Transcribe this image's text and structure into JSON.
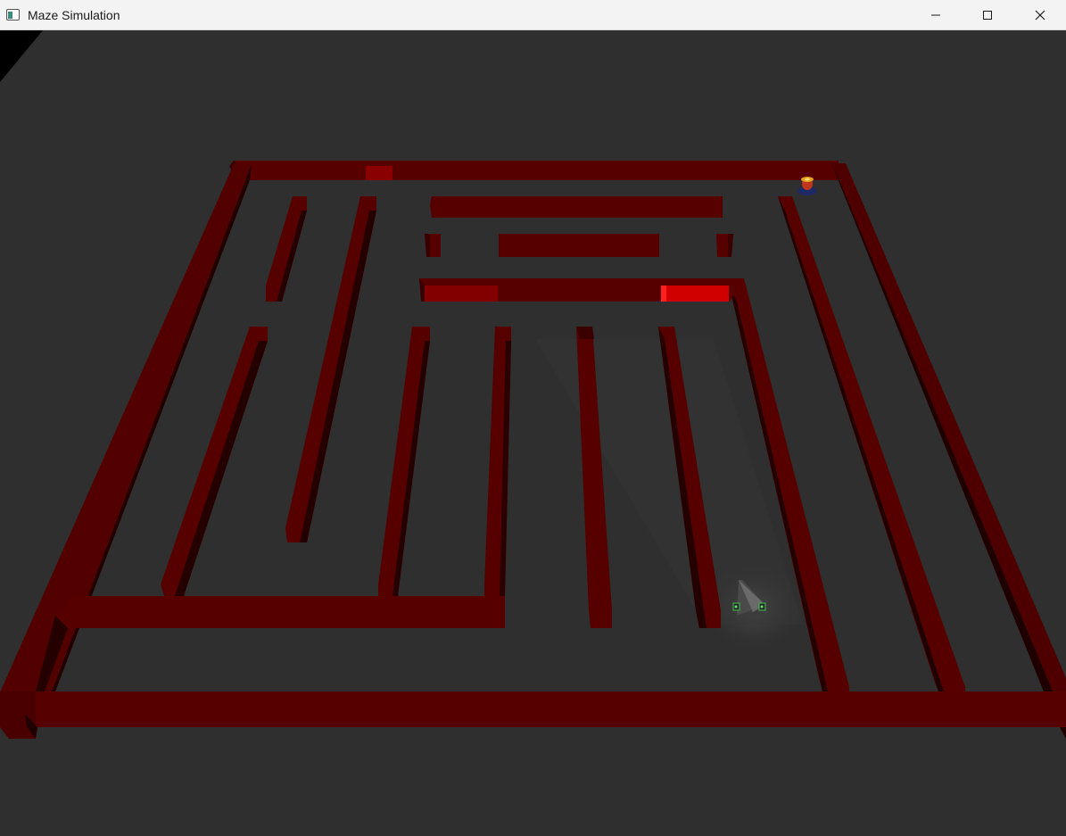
{
  "window": {
    "title": "Maze Simulation",
    "icon": "app-window-icon",
    "controls": {
      "minimize_icon": "minimize-icon",
      "maximize_icon": "maximize-icon",
      "close_icon": "close-icon"
    }
  },
  "scene": {
    "background_color": "#2f2f2f",
    "wall_color": "#560000",
    "wall_shadow_color": "#250000",
    "wall_highlight_color": "#d40000",
    "robot_icon": "robot-icon",
    "target_icon": "target-marker-icon"
  }
}
